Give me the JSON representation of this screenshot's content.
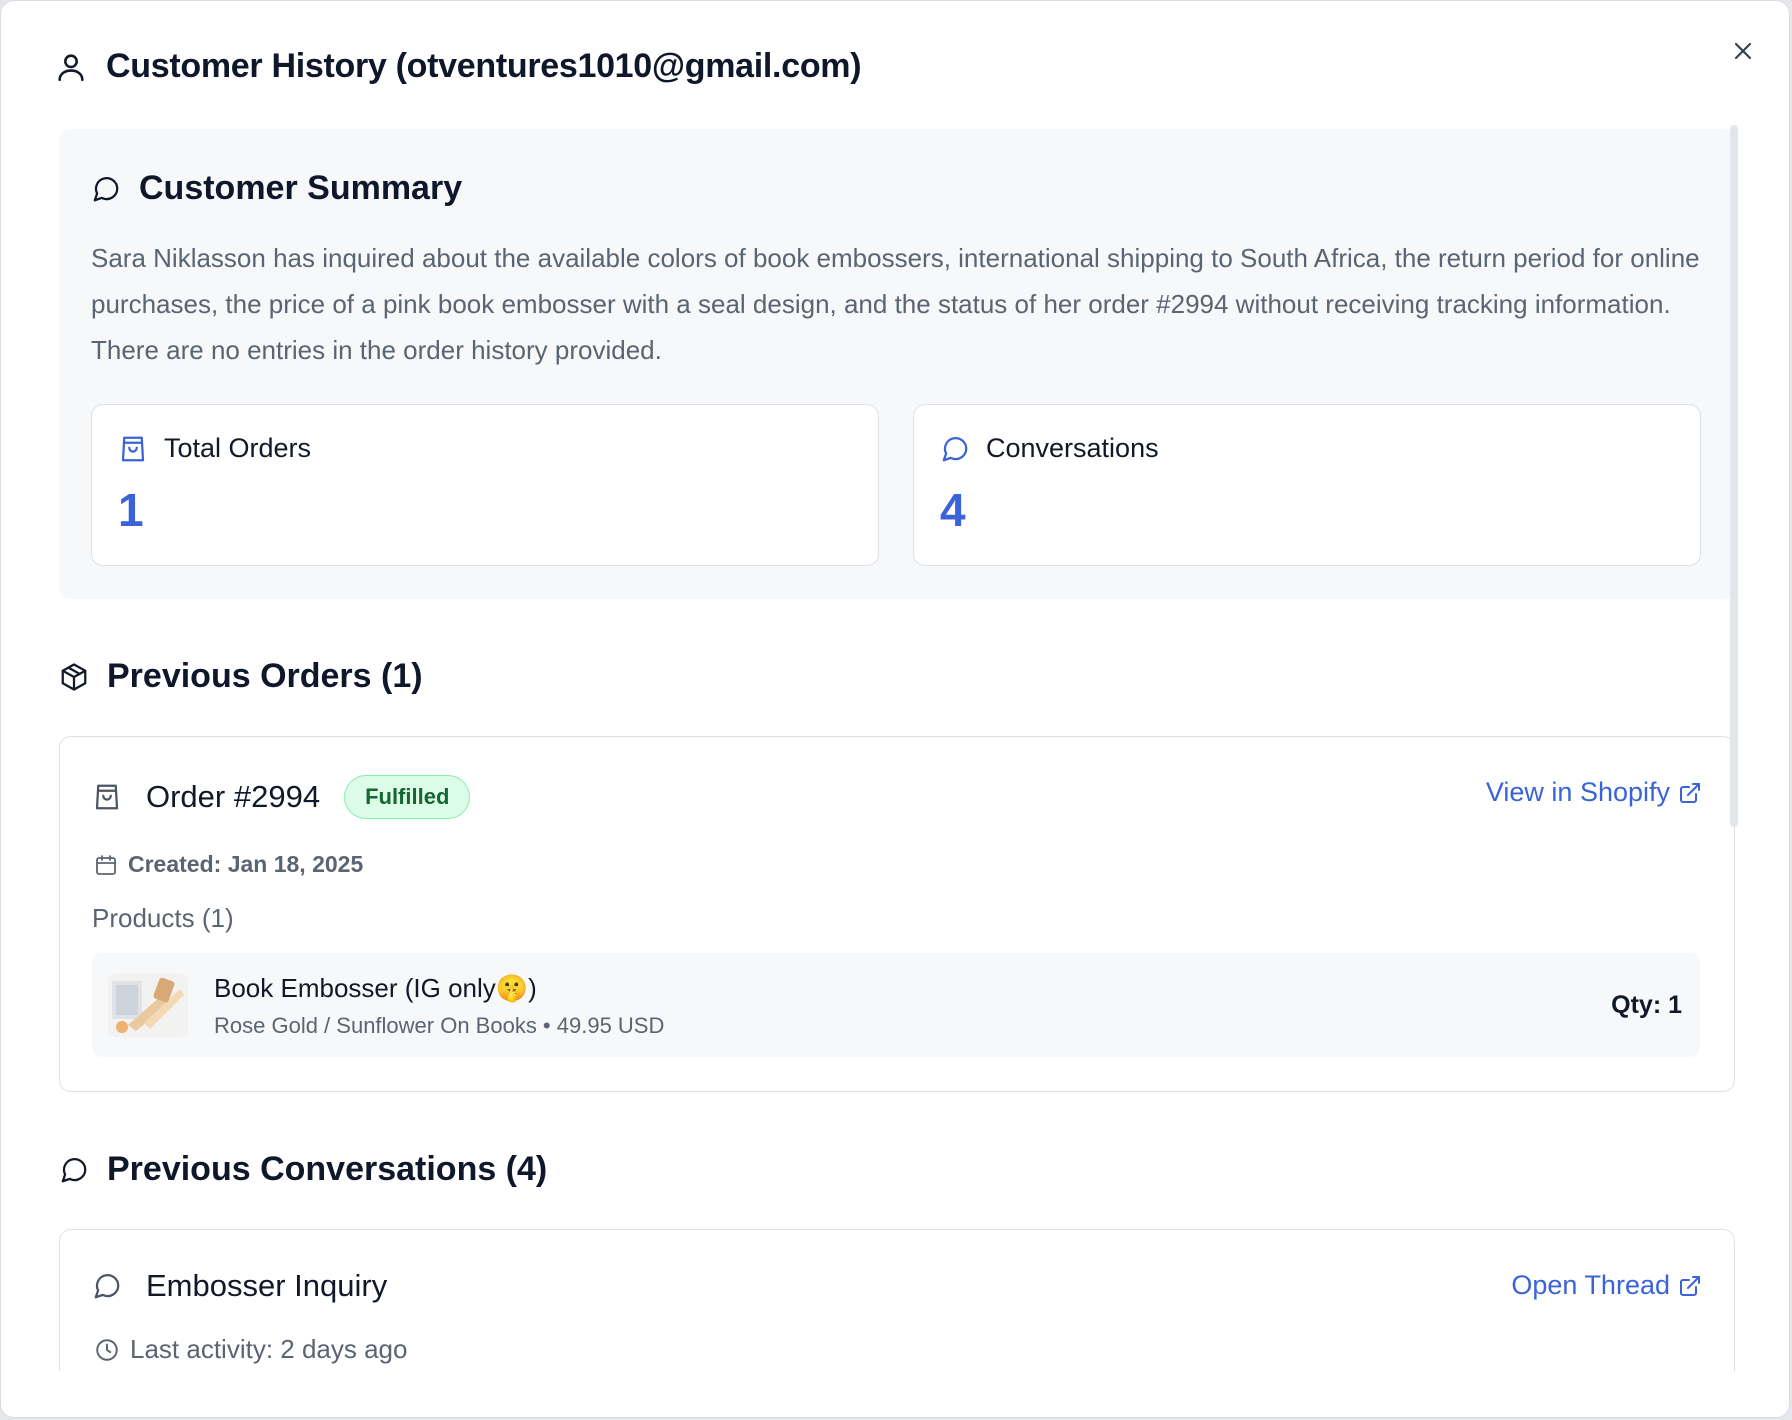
{
  "header": {
    "title": "Customer History (otventures1010@gmail.com)"
  },
  "summary": {
    "title": "Customer Summary",
    "text": "Sara Niklasson has inquired about the available colors of book embossers, international shipping to South Africa, the return period for online purchases, the price of a pink book embosser with a seal design, and the status of her order #2994 without receiving tracking information. There are no entries in the order history provided.",
    "stats": [
      {
        "label": "Total Orders",
        "value": "1",
        "icon": "shopping-bag-icon"
      },
      {
        "label": "Conversations",
        "value": "4",
        "icon": "chat-bubble-icon"
      }
    ]
  },
  "orders": {
    "title": "Previous Orders (1)",
    "items": [
      {
        "title": "Order #2994",
        "status": "Fulfilled",
        "link": "View in Shopify",
        "created": "Created: Jan 18, 2025",
        "products_label": "Products (1)",
        "products": [
          {
            "name": "Book Embosser (IG only🤫)",
            "variant": "Rose Gold / Sunflower On Books • 49.95 USD",
            "qty": "Qty: 1"
          }
        ]
      }
    ]
  },
  "conversations": {
    "title": "Previous Conversations (4)",
    "items": [
      {
        "title": "Embosser Inquiry",
        "link": "Open Thread",
        "last_activity": "Last activity: 2 days ago"
      }
    ]
  },
  "colors": {
    "accent": "#3b63d9",
    "success_bg": "#dcfce7",
    "success_text": "#166534",
    "muted_text": "#5b6472",
    "panel_bg": "#f6f8fa"
  }
}
